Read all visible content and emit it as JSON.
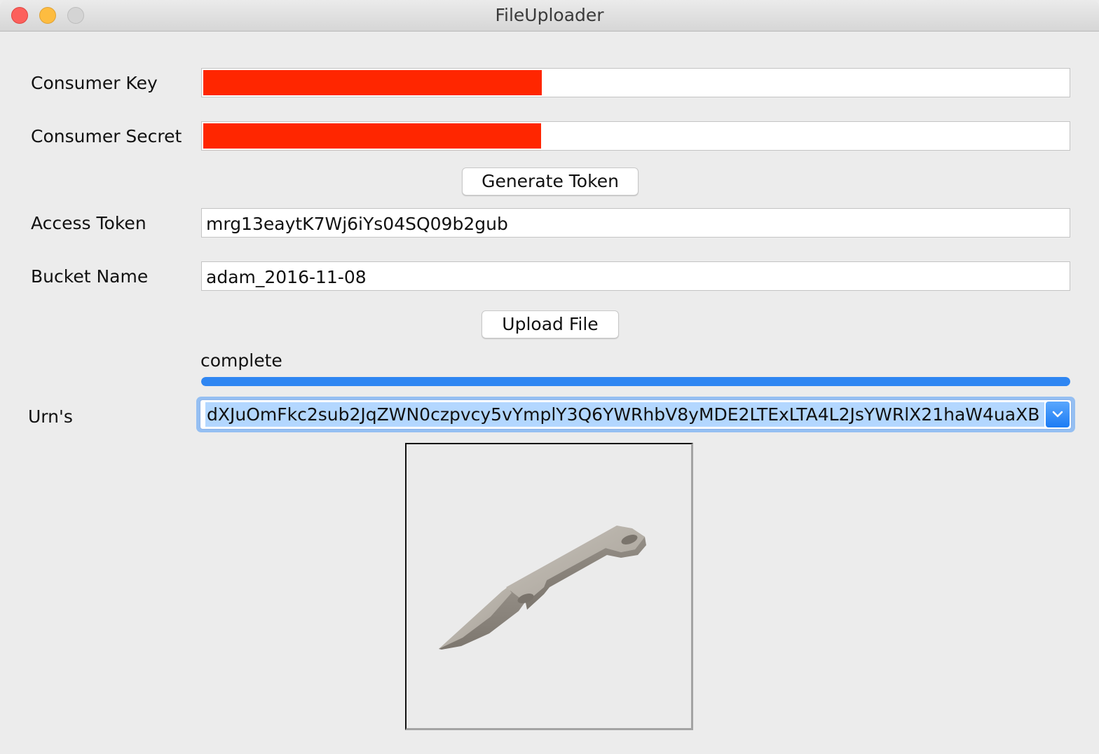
{
  "window": {
    "title": "FileUploader"
  },
  "form": {
    "consumer_key_label": "Consumer Key",
    "consumer_secret_label": "Consumer Secret",
    "redaction_color": "#ff2600",
    "generate_token_label": "Generate Token",
    "access_token_label": "Access Token",
    "access_token_value": "mrg13eaytK7Wj6iYs04SQ09b2gub",
    "bucket_name_label": "Bucket Name",
    "bucket_name_value": "adam_2016-11-08",
    "upload_file_label": "Upload File",
    "status_text": "complete",
    "progress": 1.0,
    "progress_color": "#2f86f2",
    "urns_label": "Urn's",
    "urn_selected": "dXJuOmFkc2sub2JqZWN0czpvcy5vYmplY3Q6YWRhbV8yMDE2LTExLTA4L2JsYWRlX21haW4uaXB"
  },
  "viewer": {
    "model_icon": "blade-3d-model"
  }
}
